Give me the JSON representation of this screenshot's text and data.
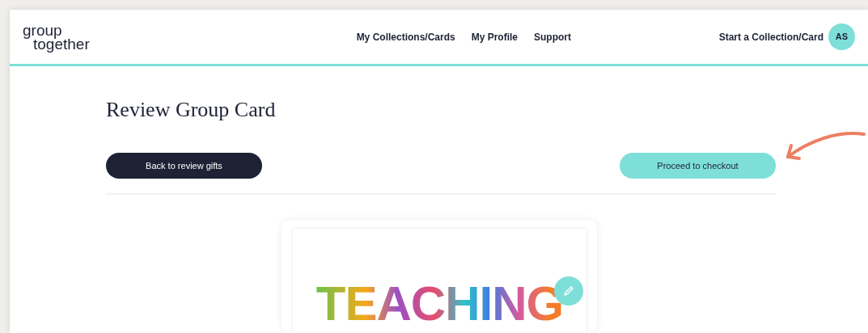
{
  "header": {
    "logo": {
      "line_1": "group",
      "line_2": "together"
    },
    "nav": [
      "My Collections/Cards",
      "My Profile",
      "Support"
    ],
    "start_link": "Start a Collection/Card",
    "avatar": "AS"
  },
  "page": {
    "title": "Review Group Card",
    "back_button": "Back to review gifts",
    "proceed_button": "Proceed to checkout"
  },
  "card": {
    "text": "TEACHING"
  }
}
